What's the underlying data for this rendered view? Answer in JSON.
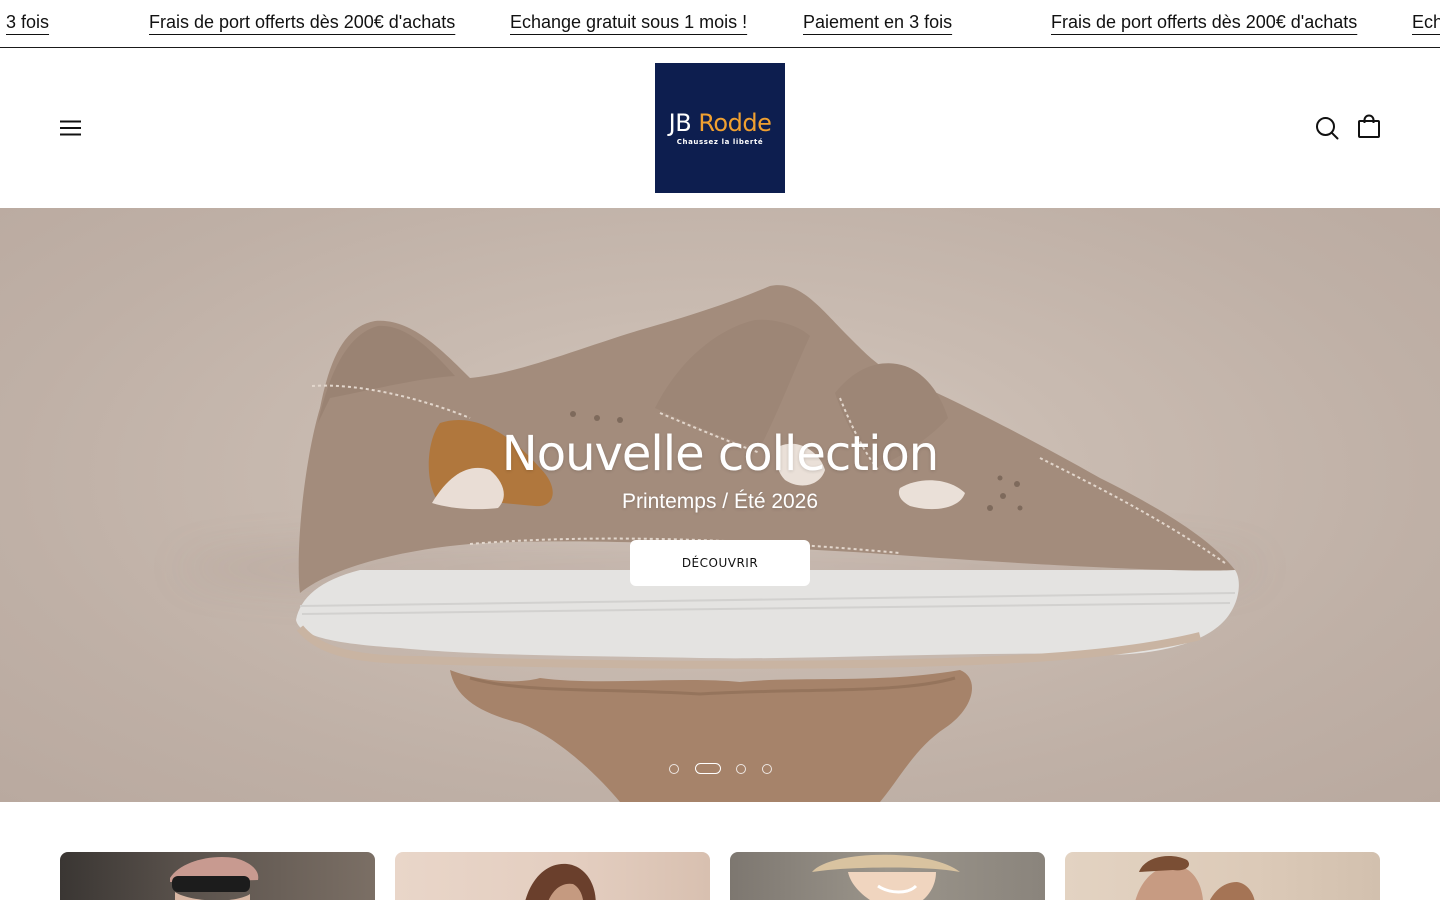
{
  "announcement": {
    "items": [
      "3 fois",
      "Frais de port offerts dès 200€ d'achats",
      "Echange gratuit sous 1 mois !",
      "Paiement en 3 fois",
      "Frais de port offerts dès 200€ d'achats",
      "Ech"
    ]
  },
  "header": {
    "logo": {
      "brand_part1": "JB ",
      "brand_part2": "Rodde",
      "tagline": "Chaussez la liberté"
    },
    "icons": {
      "menu": "hamburger-icon",
      "search": "search-icon",
      "cart": "shopping-bag-icon"
    }
  },
  "hero": {
    "title": "Nouvelle collection",
    "subtitle": "Printemps / Été 2026",
    "cta_label": "DÉCOUVRIR",
    "slides_count": 4,
    "active_slide": 2
  },
  "colors": {
    "logo_bg": "#0d1e4f",
    "logo_accent": "#f0a030",
    "hero_bg": "#c3b3a8",
    "shoe_upper": "#a38c7c",
    "sole": "#e4e3e1"
  }
}
